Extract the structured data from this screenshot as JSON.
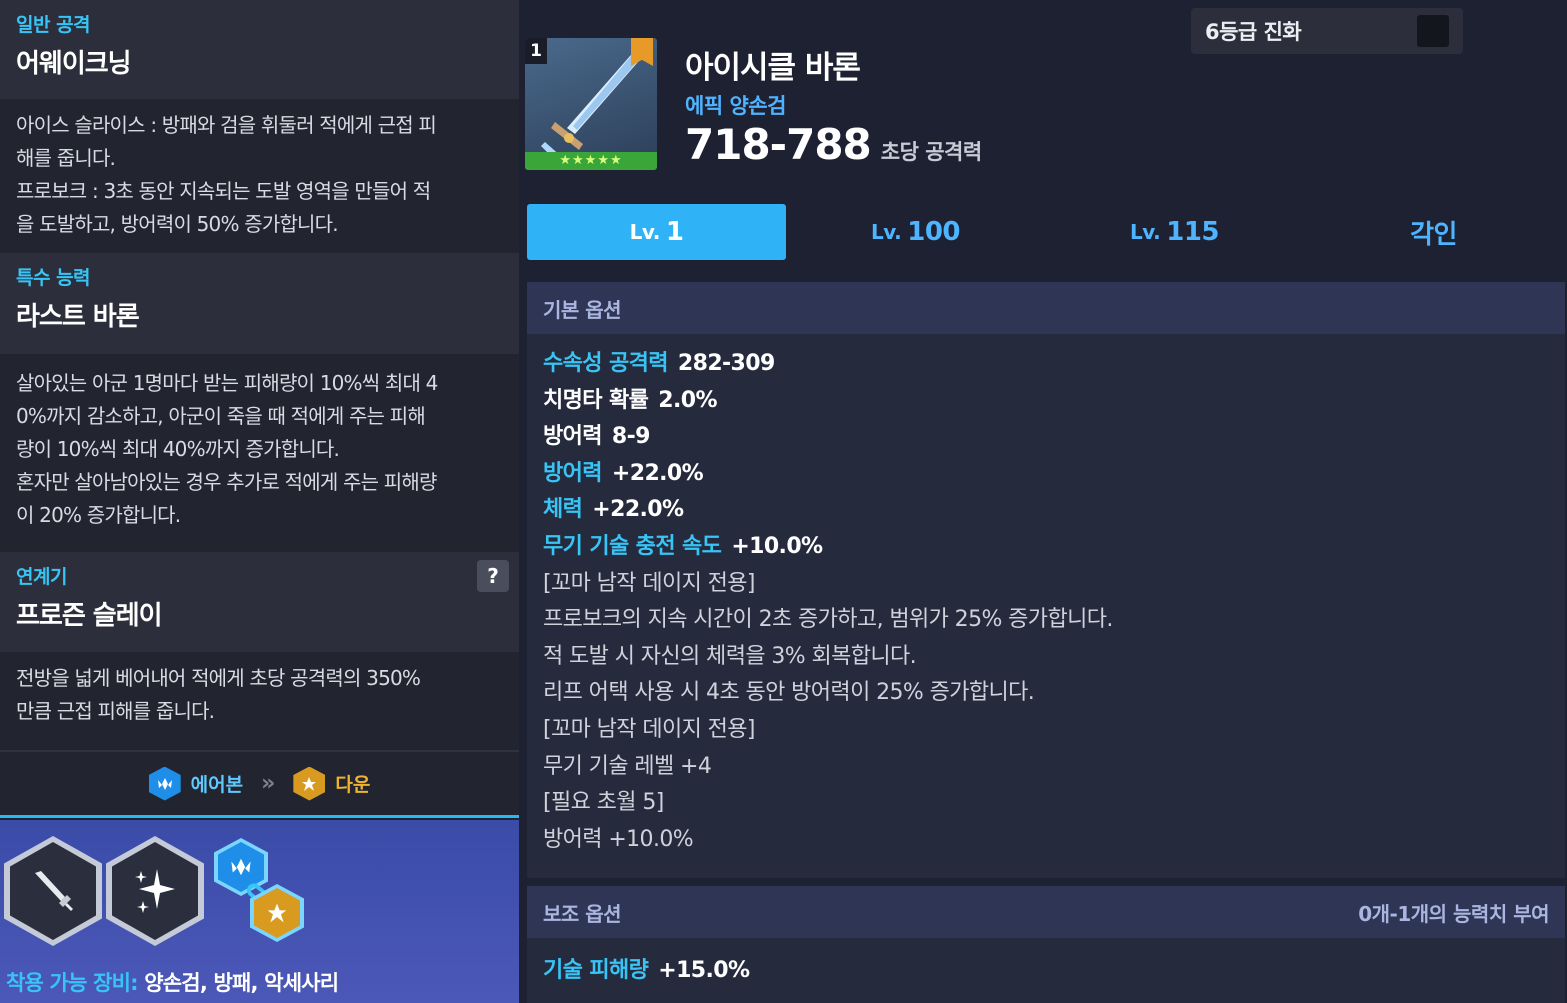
{
  "left": {
    "sections": [
      {
        "category": "일반 공격",
        "title": "어웨이크닝",
        "description": "아이스 슬라이스 : 방패와 검을 휘둘러 적에게 근접 피\n해를 줍니다.\n프로보크 : 3초 동안 지속되는 도발 영역을 만들어 적\n을 도발하고, 방어력이 50% 증가합니다."
      },
      {
        "category": "특수 능력",
        "title": "라스트 바론",
        "description": "살아있는 아군 1명마다 받는 피해량이 10%씩 최대 4\n0%까지 감소하고, 아군이 죽을 때 적에게 주는 피해\n량이 10%씩 최대 40%까지 증가합니다.\n혼자만 살아남아있는 경우 추가로 적에게 주는 피해량\n이 20% 증가합니다."
      },
      {
        "category": "연계기",
        "title": "프로즌 슬레이",
        "help_label": "?",
        "description": "전방을 넓게 베어내어 적에게 초당 공격력의 350%\n만큼 근접 피해를 줍니다."
      }
    ],
    "combo": {
      "from_label": "에어본",
      "arrow": "»",
      "to_label": "다운"
    },
    "equip": {
      "label": "착용 가능 장비:",
      "value": "양손검, 방패, 악세사리"
    }
  },
  "item": {
    "level_badge": "1",
    "stars": "★★★★★",
    "name": "아이시클 바론",
    "type": "에픽 양손검",
    "attack": "718-788",
    "attack_unit": "초당 공격력"
  },
  "evolve": {
    "label": "6등급 진화",
    "checked": false
  },
  "tabs": [
    {
      "prefix": "Lv.",
      "value": "1",
      "active": true
    },
    {
      "prefix": "Lv.",
      "value": "100",
      "active": false
    },
    {
      "prefix": "Lv.",
      "value": "115",
      "active": false
    },
    {
      "prefix": "",
      "value": "각인",
      "active": false
    }
  ],
  "base_options": {
    "header": "기본 옵션",
    "lines": [
      {
        "key": "수속성 공격력",
        "key_style": "blue",
        "value": "282-309"
      },
      {
        "key": "치명타 확률",
        "key_style": "white",
        "value": "2.0%"
      },
      {
        "key": "방어력",
        "key_style": "white",
        "value": "8-9"
      },
      {
        "key": "방어력",
        "key_style": "blue",
        "value": "+22.0%"
      },
      {
        "key": "체력",
        "key_style": "blue",
        "value": "+22.0%"
      },
      {
        "key": "무기 기술 충전 속도",
        "key_style": "blue",
        "value": "+10.0%"
      },
      {
        "text": "[꼬마 남작 데이지 전용]"
      },
      {
        "text": "프로보크의 지속 시간이 2초 증가하고, 범위가 25% 증가합니다."
      },
      {
        "text": "적 도발 시 자신의 체력을 3% 회복합니다."
      },
      {
        "text": "리프 어택 사용 시 4초 동안 방어력이 25% 증가합니다."
      },
      {
        "text": "[꼬마 남작 데이지 전용]"
      },
      {
        "text": "무기 기술 레벨 +4"
      },
      {
        "text": "[필요 초월 5]"
      },
      {
        "text": "방어력 +10.0%"
      }
    ]
  },
  "sub_options": {
    "header": "보조 옵션",
    "note": "0개-1개의 능력치 부여",
    "key": "기술 피해량",
    "value": "+15.0%"
  },
  "icons": {
    "skill1": "sword-icon",
    "skill2": "sparkle-icon",
    "chain": "chain-link-icon"
  },
  "colors": {
    "accent": "#2fb3f6",
    "category": "#38c4f5",
    "panel_gradient": "#3a4ba8"
  }
}
